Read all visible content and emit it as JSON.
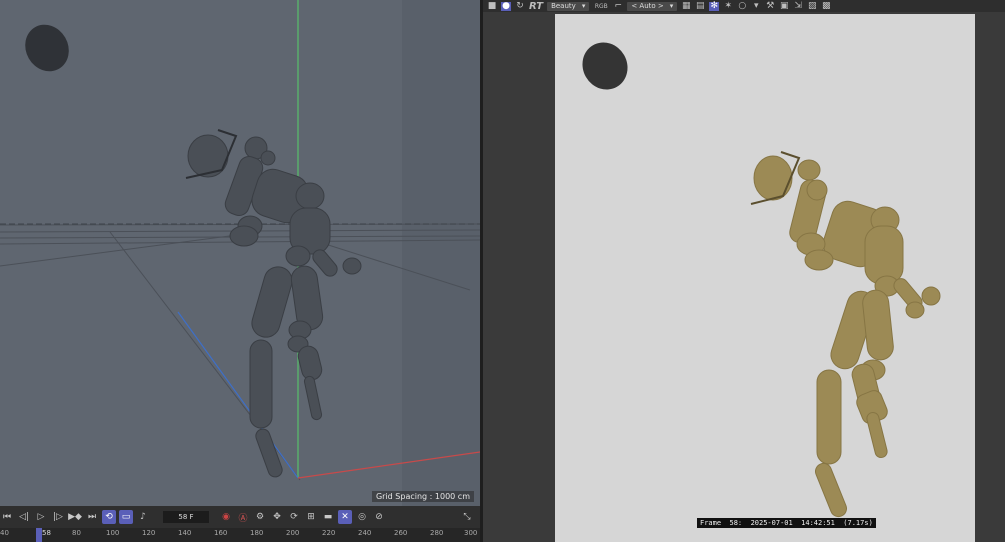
{
  "viewport": {
    "grid_label": "Grid Spacing : 1000 cm"
  },
  "render_view": {
    "toolbar": {
      "rt_label": "RT",
      "pass_select": "Beauty",
      "channel_label": "RGB",
      "auto_select": "< Auto >"
    },
    "frame_caption": "Frame  58:  2025-07-01  14:42:51  (7.17s)"
  },
  "transport": {
    "frame_field": "58 F"
  },
  "timeline": {
    "ticks": [
      "40",
      "58",
      "80",
      "100",
      "120",
      "140",
      "160",
      "180",
      "200",
      "220",
      "240",
      "260",
      "280",
      "300"
    ]
  },
  "colors": {
    "viewport_bg": "#5f6670",
    "render_bg": "#d6d6d6",
    "figure_gray": "#4a4f56",
    "figure_gold": "#9c8a55",
    "accent": "#5a5fb8"
  }
}
